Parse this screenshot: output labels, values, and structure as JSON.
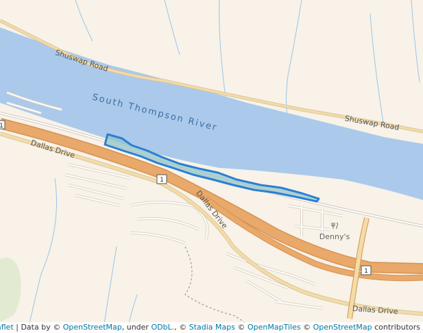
{
  "map": {
    "labels": {
      "river": "South Thompson River",
      "road_north_1": "Shuswap Road",
      "road_north_2": "Shuswap Road",
      "road_south_1": "Dallas Drive",
      "road_south_2": "Dallas Drive",
      "road_south_3": "Dallas Drive",
      "poi": "Denny's",
      "shield_1": "1",
      "shield_2": "1",
      "shield_3": "1"
    },
    "colors": {
      "land": "#f8f2e8",
      "water": "#abc9ea",
      "highway": "#e8a96a",
      "highway_casing": "#d69150",
      "minor_road": "#ffffff",
      "road_outline": "#dcd3c6",
      "polygon_fill": "#8ec3c9",
      "polygon_stroke": "#2a7fd4",
      "park": "#e3ead2"
    },
    "icons": {
      "poi_icon": "restaurant-icon"
    }
  },
  "attribution": {
    "leaflet": "Leaflet",
    "sep1": " | Data by © ",
    "osm": "OpenStreetMap",
    "under": ", under ",
    "odbl": "ODbL.",
    "sep2": ", © ",
    "stadia": "Stadia Maps",
    "sep3": " © ",
    "omt": "OpenMapTiles",
    "sep4": " © ",
    "osm2": "OpenStreetMap",
    "contrib": " contributors"
  }
}
